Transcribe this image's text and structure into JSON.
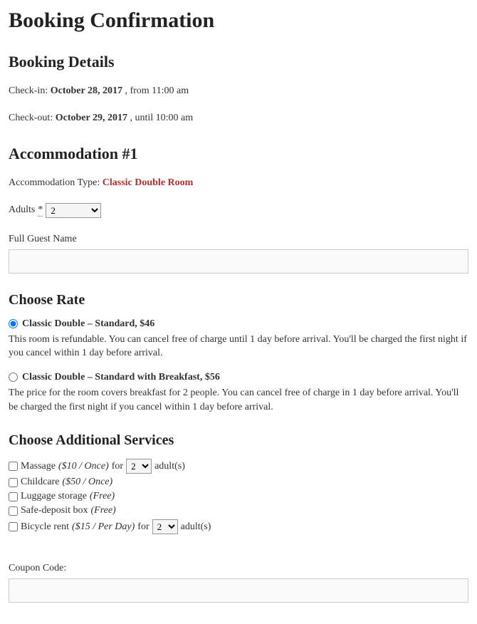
{
  "page_title": "Booking Confirmation",
  "booking_details": {
    "heading": "Booking Details",
    "checkin_label": "Check-in:",
    "checkin_date": "October 28, 2017",
    "checkin_suffix": ", from 11:00 am",
    "checkout_label": "Check-out:",
    "checkout_date": "October 29, 2017",
    "checkout_suffix": ", until 10:00 am"
  },
  "accommodation": {
    "heading": "Accommodation #1",
    "type_label": "Accommodation Type:",
    "type_value": "Classic Double Room",
    "adults_label": "Adults",
    "adults_required": "*",
    "adults_value": "2",
    "fullname_label": "Full Guest Name"
  },
  "rate": {
    "heading": "Choose Rate",
    "options": [
      {
        "label": "Classic Double – Standard, $46",
        "desc": "This room is refundable. You can cancel free of charge until 1 day before arrival. You'll be charged the first night if you cancel within 1 day before arrival."
      },
      {
        "label": "Classic Double – Standard with Breakfast, $56",
        "desc": "The price for the room covers breakfast for 2 people. You can cancel free of charge in 1 day before arrival. You'll be charged the first night if you cancel within 1 day before arrival."
      }
    ]
  },
  "services": {
    "heading": "Choose Additional Services",
    "for_text": "for",
    "adults_suffix": "adult(s)",
    "items": [
      {
        "name": "Massage",
        "price": "($10 / Once)",
        "has_qty": true,
        "qty": "2"
      },
      {
        "name": "Childcare",
        "price": "($50 / Once)",
        "has_qty": false
      },
      {
        "name": "Luggage storage",
        "price": "(Free)",
        "has_qty": false
      },
      {
        "name": "Safe-deposit box",
        "price": "(Free)",
        "has_qty": false
      },
      {
        "name": "Bicycle rent",
        "price": "($15 / Per Day)",
        "has_qty": true,
        "qty": "2"
      }
    ]
  },
  "coupon": {
    "label": "Coupon Code:"
  }
}
